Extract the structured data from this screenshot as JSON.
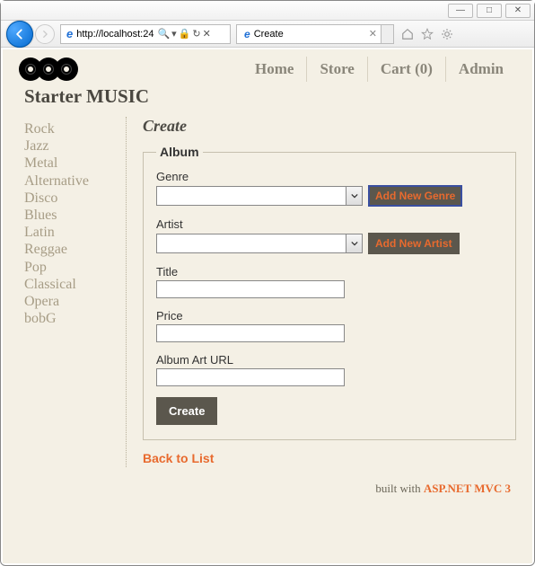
{
  "window": {
    "minimize": "—",
    "maximize": "□",
    "close": "✕"
  },
  "browser": {
    "url": "http://localhost:24",
    "tab_title": "Create"
  },
  "brand": "Starter MUSIC",
  "top_nav": {
    "home": "Home",
    "store": "Store",
    "cart": "Cart (0)",
    "admin": "Admin"
  },
  "sidebar": {
    "items": [
      "Rock",
      "Jazz",
      "Metal",
      "Alternative",
      "Disco",
      "Blues",
      "Latin",
      "Reggae",
      "Pop",
      "Classical",
      "Opera",
      "bobG"
    ]
  },
  "page": {
    "title": "Create",
    "fieldset_legend": "Album",
    "genre_label": "Genre",
    "genre_value": "",
    "add_genre_label": "Add New Genre",
    "artist_label": "Artist",
    "artist_value": "",
    "add_artist_label": "Add New Artist",
    "title_label": "Title",
    "title_value": "",
    "price_label": "Price",
    "price_value": "",
    "arturl_label": "Album Art URL",
    "arturl_value": "",
    "create_button": "Create",
    "back_link": "Back to List"
  },
  "footer": {
    "prefix": "built with ",
    "framework": "ASP.NET MVC 3"
  }
}
